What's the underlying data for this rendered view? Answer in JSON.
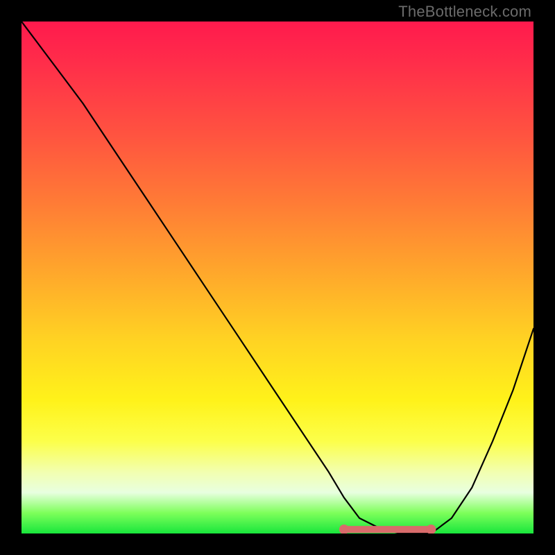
{
  "watermark": "TheBottleneck.com",
  "chart_data": {
    "type": "line",
    "title": "",
    "xlabel": "",
    "ylabel": "",
    "xlim": [
      0,
      100
    ],
    "ylim": [
      0,
      100
    ],
    "series": [
      {
        "name": "curve",
        "x": [
          0,
          6,
          12,
          18,
          24,
          30,
          36,
          42,
          48,
          54,
          60,
          63,
          66,
          70,
          74,
          77,
          80,
          84,
          88,
          92,
          96,
          100
        ],
        "y": [
          100,
          92,
          84,
          75,
          66,
          57,
          48,
          39,
          30,
          21,
          12,
          7,
          3,
          1,
          0,
          0,
          0,
          3,
          9,
          18,
          28,
          40
        ]
      }
    ],
    "markers": [
      {
        "name": "flat-region-left",
        "x": 63,
        "y": 0.8
      },
      {
        "name": "flat-region-right",
        "x": 80,
        "y": 0.8
      }
    ],
    "flat_segment": {
      "x_start": 63,
      "x_end": 80,
      "y": 0.8
    },
    "colors": {
      "curve": "#000000",
      "marker": "#d96b6b",
      "flat": "#d96b6b",
      "gradient_top": "#ff1a4d",
      "gradient_mid": "#ffd223",
      "gradient_bottom": "#18e63c",
      "frame": "#000000"
    }
  }
}
